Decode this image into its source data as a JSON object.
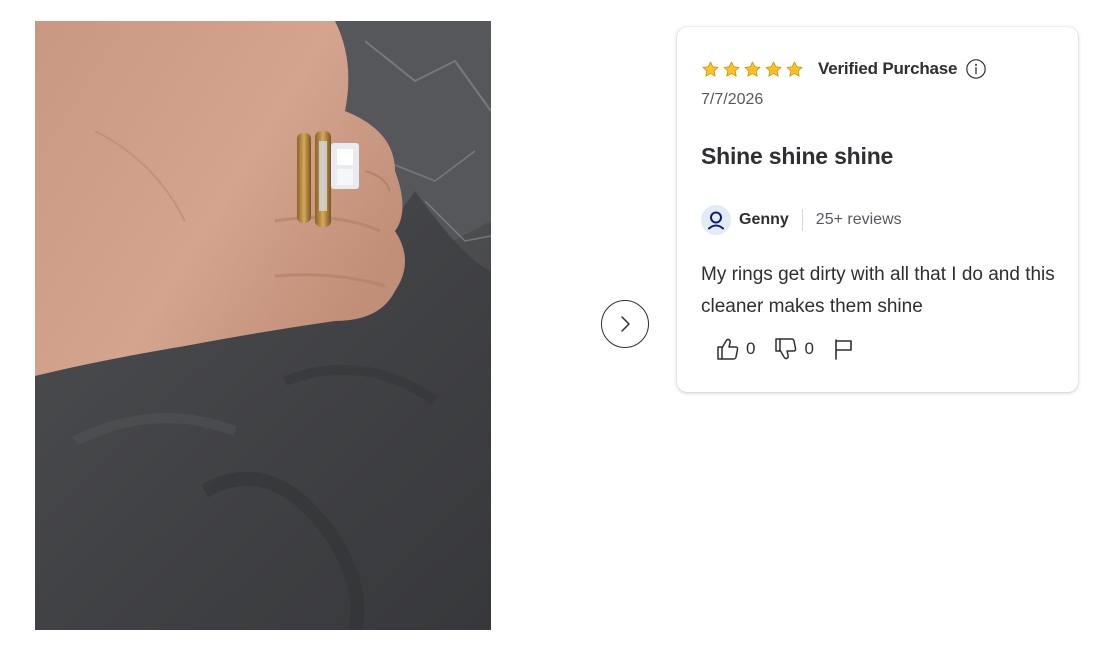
{
  "photo": {
    "subject": "Hand wearing gold ring set on dark fabric"
  },
  "carousel": {
    "next_icon": "chevron-right-icon"
  },
  "review": {
    "rating": 5,
    "rating_max": 5,
    "star_color": "#ffc220",
    "verified_label": "Verified Purchase",
    "info_icon": "info-icon",
    "date": "7/7/2026",
    "title": "Shine shine shine",
    "reviewer": {
      "avatar_icon": "user-icon",
      "avatar_color": "#0e1f6b",
      "name": "Genny",
      "review_count": "25+ reviews"
    },
    "body": "My rings get dirty with all that I do and this cleaner makes them shine",
    "helpful": {
      "icon": "thumbs-up-icon",
      "count": "0"
    },
    "not_helpful": {
      "icon": "thumbs-down-icon",
      "count": "0"
    },
    "report": {
      "icon": "flag-icon"
    }
  }
}
